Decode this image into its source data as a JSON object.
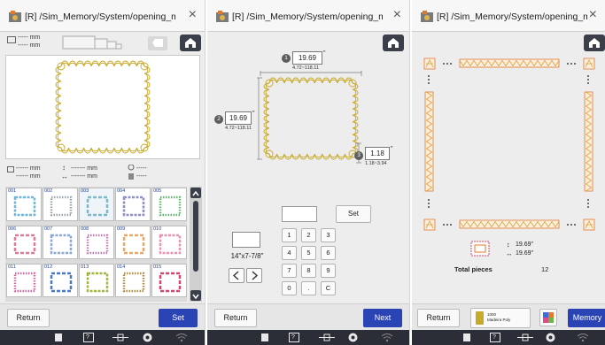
{
  "window_title": "[R] /Sim_Memory/System/opening_m...",
  "close_glyph": "×",
  "status_bar": {
    "icons": [
      "document-icon",
      "help-icon",
      "thread-icon",
      "settings-icon",
      "wifi-icon"
    ],
    "help_label": "?"
  },
  "panel1": {
    "tool_size": "----- mm",
    "tool_size2": "----- mm",
    "info_row1": [
      "------ mm",
      "------- mm",
      "-----"
    ],
    "info_row2": [
      "------ mm",
      "------- mm",
      "-----"
    ],
    "grid_items": [
      {
        "num": "001",
        "color": "#6fb7d6"
      },
      {
        "num": "002",
        "color": "#9aa6ad"
      },
      {
        "num": "003",
        "color": "#7fb8cc"
      },
      {
        "num": "004",
        "color": "#8e8ec8"
      },
      {
        "num": "005",
        "color": "#63b86e"
      },
      {
        "num": "006",
        "color": "#e07c9b"
      },
      {
        "num": "007",
        "color": "#8aa8d8"
      },
      {
        "num": "008",
        "color": "#c678b8"
      },
      {
        "num": "009",
        "color": "#e8a86a"
      },
      {
        "num": "010",
        "color": "#e892b5"
      },
      {
        "num": "011",
        "color": "#d765a5"
      },
      {
        "num": "012",
        "color": "#4a78c7"
      },
      {
        "num": "013",
        "color": "#a2b63f"
      },
      {
        "num": "014",
        "color": "#b58a3c"
      },
      {
        "num": "015",
        "color": "#d9426a"
      }
    ],
    "return_label": "Return",
    "set_label": "Set"
  },
  "panel2": {
    "width_badge": "1",
    "width_value": "19.69",
    "width_unit": "\"",
    "width_range": "4.72~118.11",
    "height_badge": "2",
    "height_value": "19.69",
    "height_unit": "\"",
    "height_range": "4.72~118.11",
    "spacing_badge": "3",
    "spacing_value": "1.18",
    "spacing_unit": "\"",
    "spacing_range": "1.18~3.94",
    "set_label": "Set",
    "hoop_label": "14\"x7-7/8\"",
    "keys": [
      "1",
      "2",
      "3",
      "4",
      "5",
      "6",
      "7",
      "8",
      "9",
      "0",
      ".",
      "C"
    ],
    "return_label": "Return",
    "next_label": "Next"
  },
  "panel3": {
    "height_value": "19.69",
    "width_value": "19.69",
    "unit": "\"",
    "total_pieces_label": "Total pieces",
    "total_pieces_value": "12",
    "thread_name": "1000\nMadeira Poly",
    "return_label": "Return",
    "memory_label": "Memory"
  },
  "colors": {
    "gold": "#c8a92a",
    "blue": "#2a43b5",
    "dark": "#3a3f4a",
    "orange": "#e0782e"
  }
}
